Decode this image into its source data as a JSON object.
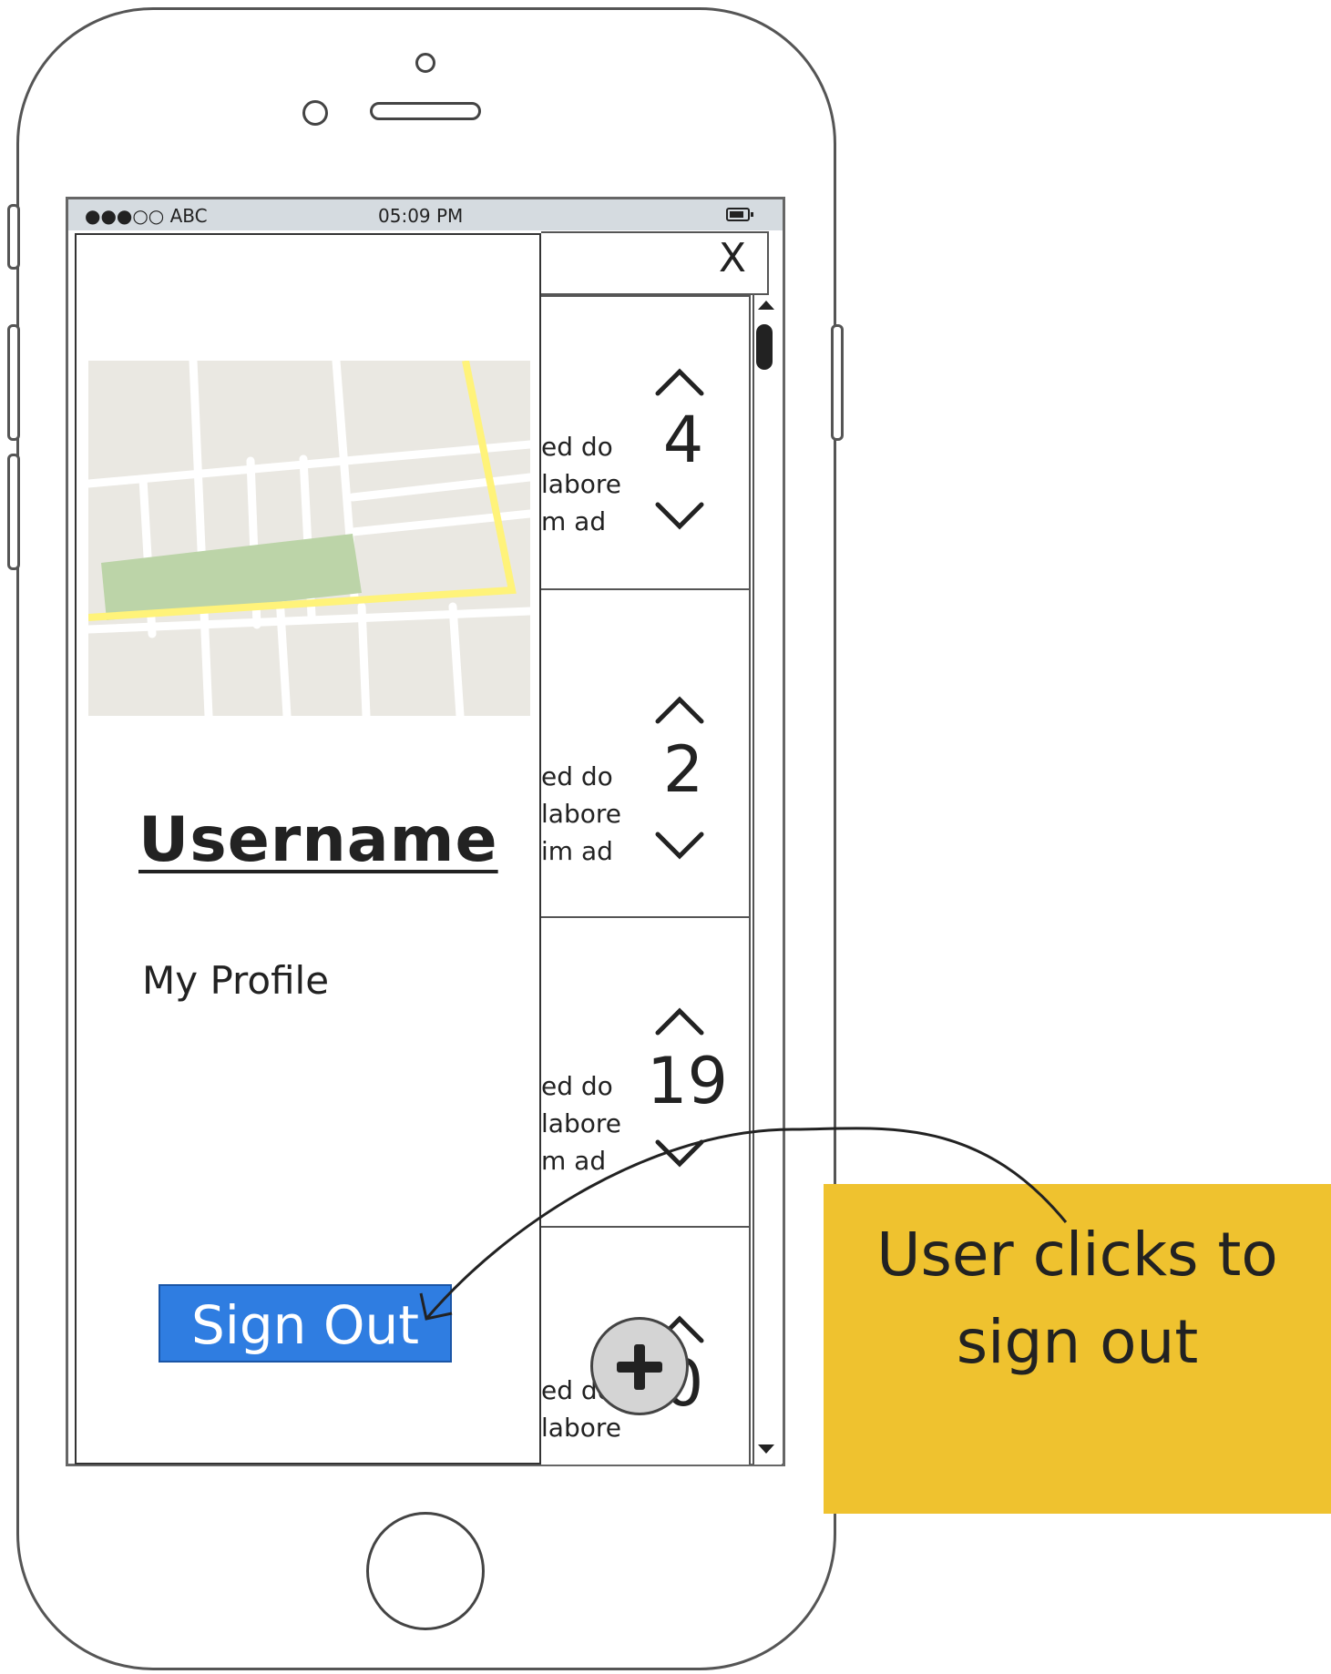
{
  "status_bar": {
    "carrier": "●●●○○ ABC",
    "time": "05:09 PM"
  },
  "top_bar": {
    "close_label": "X"
  },
  "list_items": [
    {
      "text_lines": [
        "ed do",
        "labore",
        "m ad"
      ],
      "count": "4"
    },
    {
      "text_lines": [
        "ed do",
        "labore",
        "im ad"
      ],
      "count": "2"
    },
    {
      "text_lines": [
        "ed do",
        "labore",
        "m ad"
      ],
      "count": "19"
    },
    {
      "text_lines": [
        "ed do",
        "labore"
      ],
      "count": "0"
    }
  ],
  "drawer": {
    "username": "Username",
    "my_profile": "My Profile",
    "sign_out": "Sign Out"
  },
  "note": {
    "line1": "User clicks to",
    "line2": "sign out"
  },
  "colors": {
    "sign_out_bg": "#2f7de1",
    "note_bg": "#efc22f",
    "map_bg": "#eae8e2",
    "map_route": "#fff37a",
    "map_park": "#bcd4a8"
  },
  "icons": {
    "close": "close-icon",
    "upvote": "chevron-up-icon",
    "downvote": "chevron-down-icon",
    "fab": "plus-icon",
    "battery": "battery-icon"
  }
}
